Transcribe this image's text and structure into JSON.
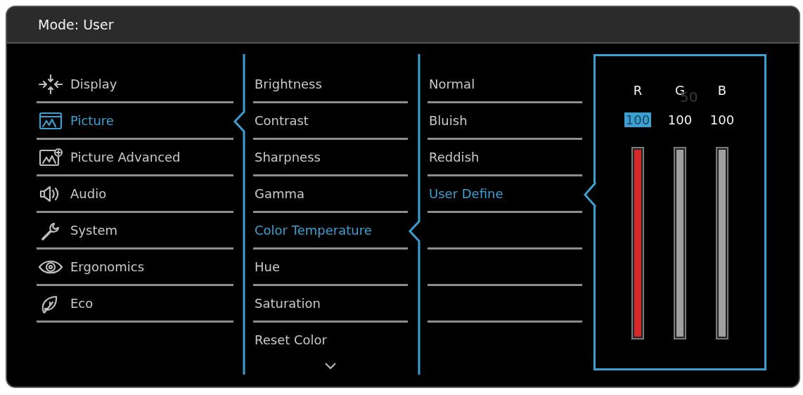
{
  "title": "Mode: User",
  "menu": [
    {
      "label": "Display",
      "selected": false
    },
    {
      "label": "Picture",
      "selected": true
    },
    {
      "label": "Picture Advanced",
      "selected": false
    },
    {
      "label": "Audio",
      "selected": false
    },
    {
      "label": "System",
      "selected": false
    },
    {
      "label": "Ergonomics",
      "selected": false
    },
    {
      "label": "Eco",
      "selected": false
    }
  ],
  "picture_menu": [
    {
      "label": "Brightness",
      "selected": false
    },
    {
      "label": "Contrast",
      "selected": false
    },
    {
      "label": "Sharpness",
      "selected": false
    },
    {
      "label": "Gamma",
      "selected": false
    },
    {
      "label": "Color Temperature",
      "selected": true
    },
    {
      "label": "Hue",
      "selected": false
    },
    {
      "label": "Saturation",
      "selected": false
    },
    {
      "label": "Reset Color",
      "selected": false
    }
  ],
  "color_temperature": [
    {
      "label": "Normal",
      "selected": false
    },
    {
      "label": "Bluish",
      "selected": false
    },
    {
      "label": "Reddish",
      "selected": false
    },
    {
      "label": "User Define",
      "selected": true
    }
  ],
  "channels": [
    {
      "label": "R",
      "value": "100",
      "selected": true,
      "level": 1
    },
    {
      "label": "G",
      "value": "100",
      "selected": false,
      "level": 1
    },
    {
      "label": "B",
      "value": "100",
      "selected": false,
      "level": 1
    }
  ],
  "faded_value": "50"
}
